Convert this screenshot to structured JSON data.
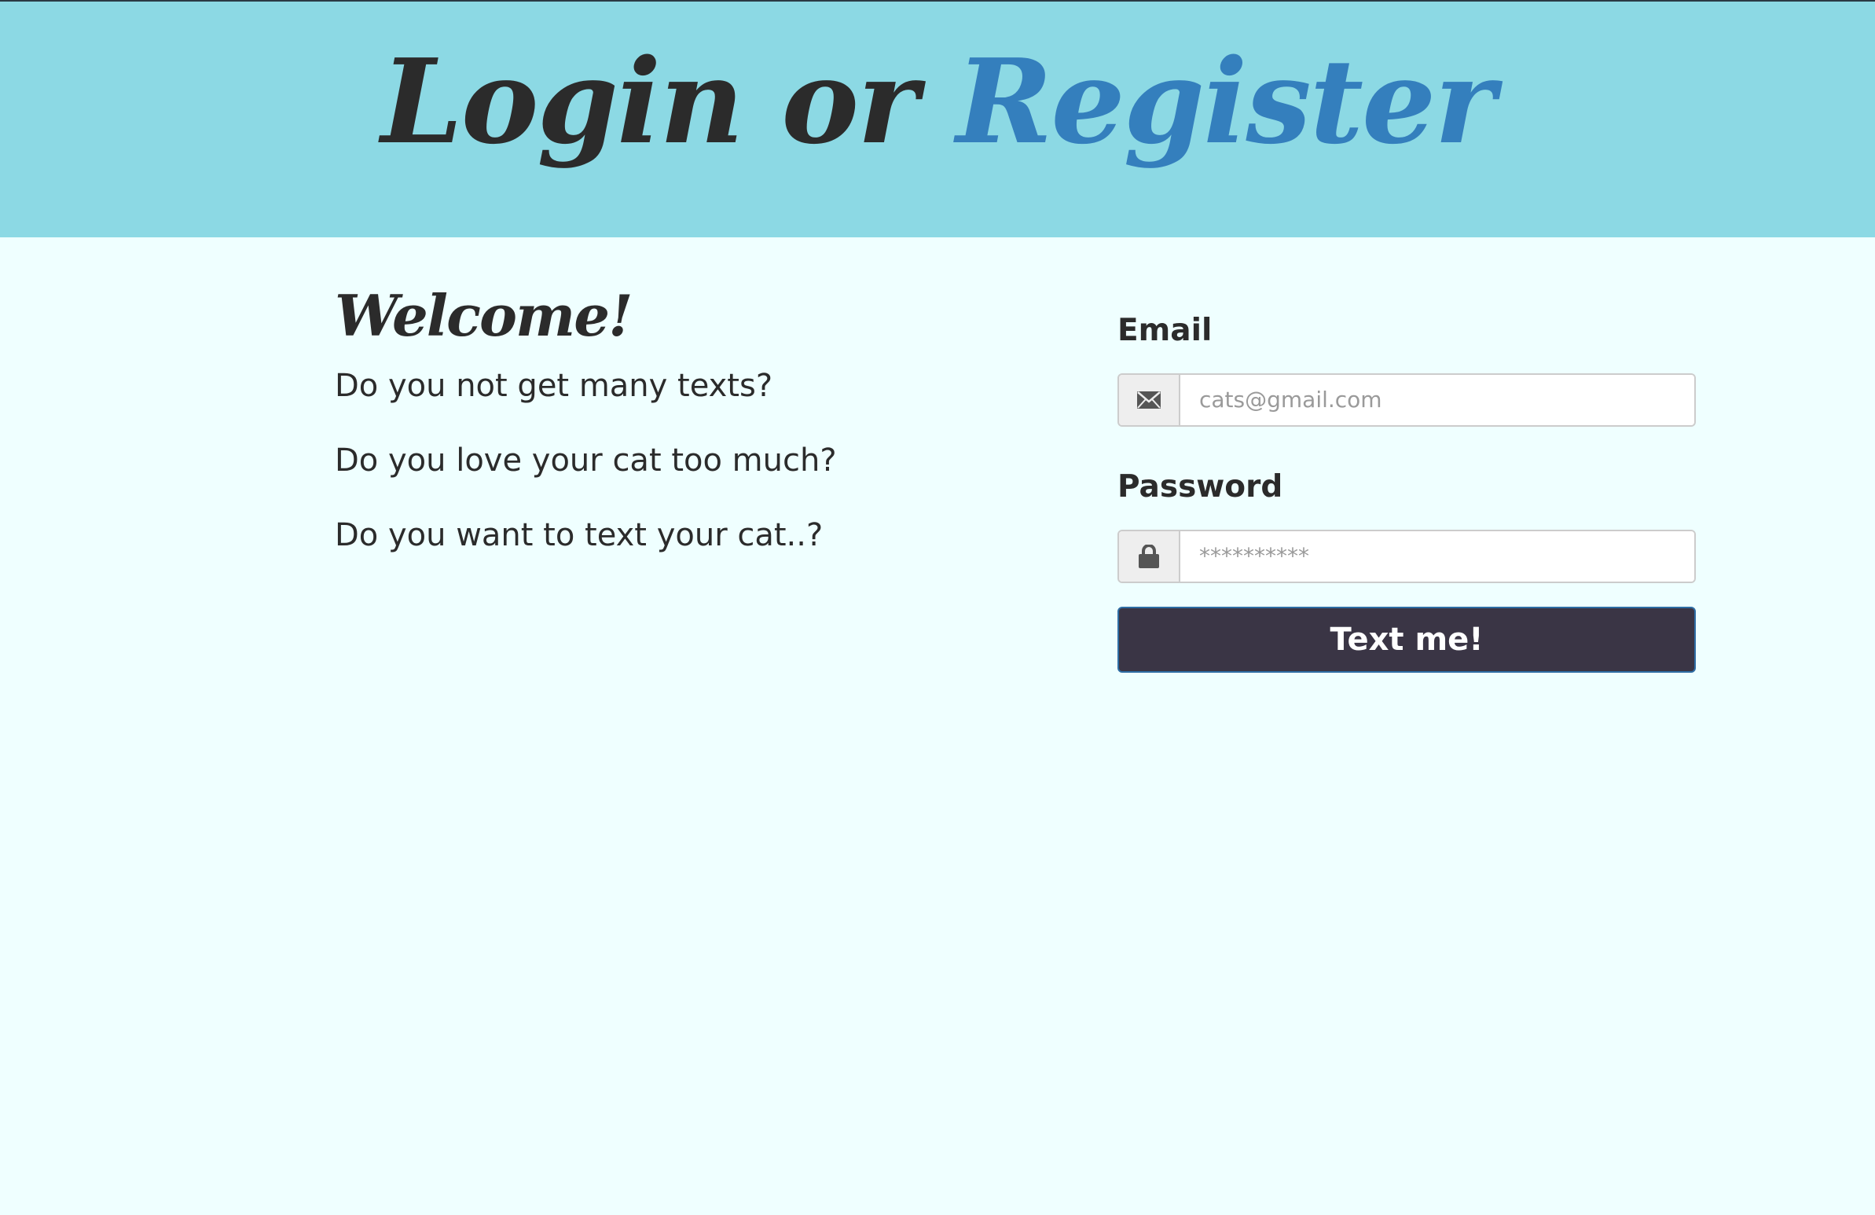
{
  "header": {
    "title_main": "Login or ",
    "title_accent": "Register"
  },
  "intro": {
    "heading": "Welcome!",
    "questions": [
      "Do you not get many texts?",
      "Do you love your cat too much?",
      "Do you want to text your cat..?"
    ]
  },
  "form": {
    "email": {
      "label": "Email",
      "value": "",
      "placeholder": "cats@gmail.com",
      "icon": "envelope-icon"
    },
    "password": {
      "label": "Password",
      "value": "",
      "placeholder": "**********",
      "icon": "lock-icon"
    },
    "submit_label": "Text me!"
  },
  "colors": {
    "header_bg": "#8cd9e4",
    "page_bg": "#efffff",
    "accent": "#347fbd",
    "button_bg": "#3a3545",
    "text": "#2b2b2b"
  }
}
